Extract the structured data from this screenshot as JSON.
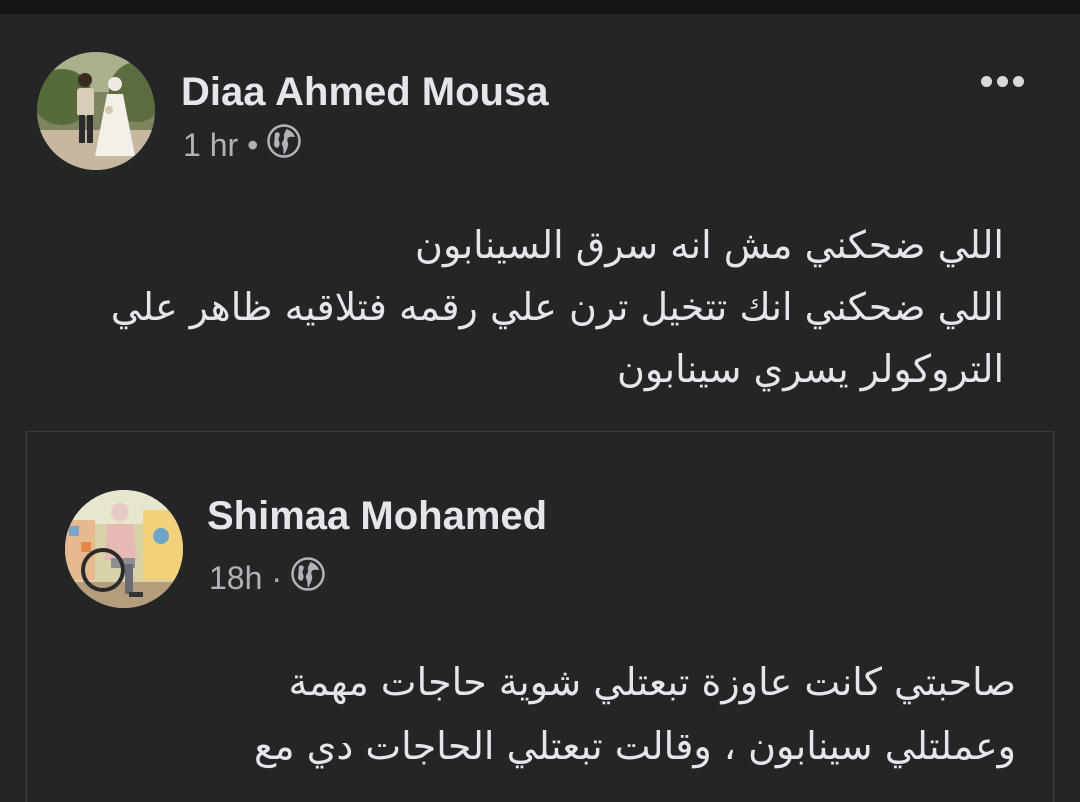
{
  "post": {
    "author": "Diaa Ahmed Mousa",
    "time": "1 hr",
    "separator": "•",
    "privacy_icon": "globe-icon",
    "more_icon": "more-options-icon",
    "text_lines": [
      "اللي ضحكني مش انه سرق السينابون",
      "اللي ضحكني انك تتخيل ترن علي رقمه فتلاقيه ظاهر علي",
      "التروكولر يسري سينابون"
    ]
  },
  "shared_post": {
    "author": "Shimaa Mohamed",
    "time": "18h",
    "separator": "·",
    "privacy_icon": "globe-icon",
    "text_lines": [
      "صاحبتي كانت عاوزة تبعتلي شوية حاجات مهمة",
      "وعملتلي سينابون ، وقالت تبعتلي الحاجات دي مع"
    ]
  },
  "colors": {
    "background": "#242526",
    "top_bar": "#151516",
    "primary_text": "#e4e6eb",
    "secondary_text": "#b0b3b8",
    "border": "#3a3b3c"
  }
}
